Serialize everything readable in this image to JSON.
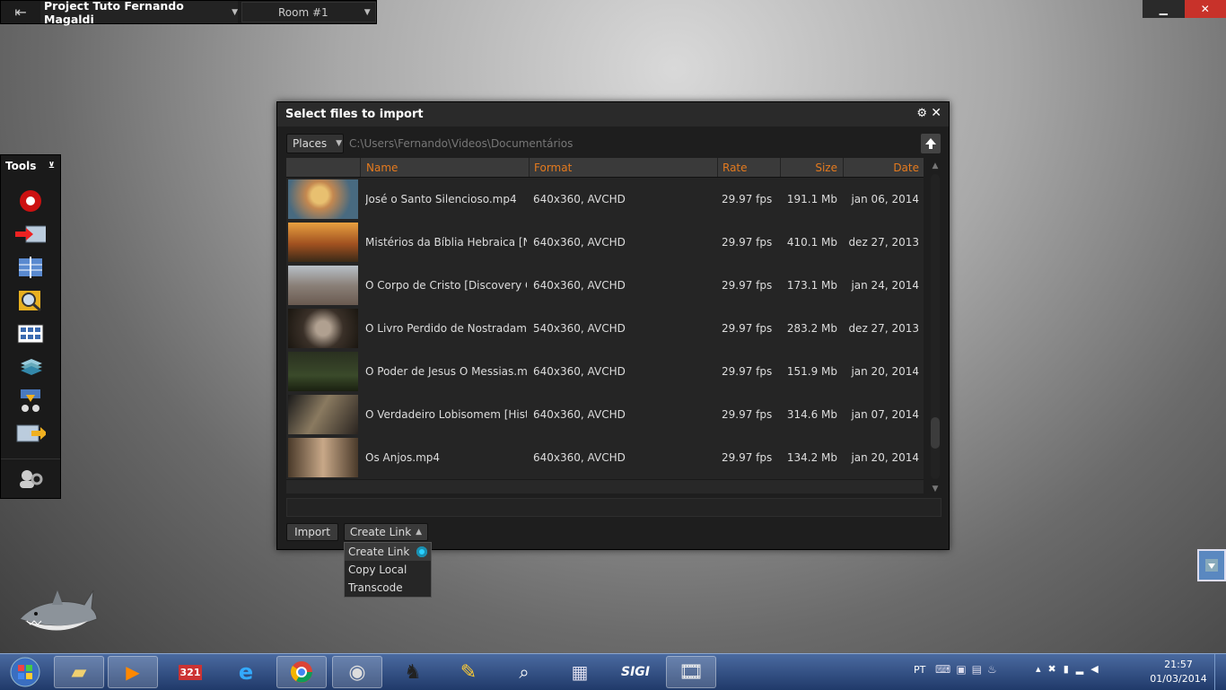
{
  "topbar": {
    "project": "Project Tuto Fernando Magaldi",
    "room": "Room #1"
  },
  "window_controls": {
    "minimize": "▁",
    "close": "✕"
  },
  "tools": {
    "title": "Tools"
  },
  "dialog": {
    "title": "Select files to import",
    "places": "Places",
    "path": "C:\\Users\\Fernando\\Videos\\Documentários",
    "columns": {
      "name": "Name",
      "format": "Format",
      "rate": "Rate",
      "size": "Size",
      "date": "Date"
    },
    "rows": [
      {
        "name": "José o Santo Silencioso.mp4",
        "format": "640x360, AVCHD",
        "rate": "29.97 fps",
        "size": "191.1 Mb",
        "date": "jan 06, 2014"
      },
      {
        "name": "Mistérios da Bíblia Hebraica [Na",
        "format": "640x360, AVCHD",
        "rate": "29.97 fps",
        "size": "410.1 Mb",
        "date": "dez 27, 2013"
      },
      {
        "name": "O Corpo de Cristo [Discovery Ci",
        "format": "640x360, AVCHD",
        "rate": "29.97 fps",
        "size": "173.1 Mb",
        "date": "jan 24, 2014"
      },
      {
        "name": "O Livro Perdido de Nostradamus",
        "format": "540x360, AVCHD",
        "rate": "29.97 fps",
        "size": "283.2 Mb",
        "date": "dez 27, 2013"
      },
      {
        "name": "O Poder de Jesus   O Messias.m",
        "format": "640x360, AVCHD",
        "rate": "29.97 fps",
        "size": "151.9 Mb",
        "date": "jan 20, 2014"
      },
      {
        "name": "O Verdadeiro Lobisomem [Histo",
        "format": "640x360, AVCHD",
        "rate": "29.97 fps",
        "size": "314.6 Mb",
        "date": "jan 07, 2014"
      },
      {
        "name": "Os Anjos.mp4",
        "format": "640x360, AVCHD",
        "rate": "29.97 fps",
        "size": "134.2 Mb",
        "date": "jan 20, 2014"
      }
    ],
    "import_button": "Import",
    "mode_button": "Create Link",
    "mode_options": [
      "Create Link",
      "Copy Local",
      "Transcode"
    ]
  },
  "taskbar": {
    "lang": "PT",
    "time": "21:57",
    "date": "01/03/2014"
  },
  "colors": {
    "accent": "#e47a1e",
    "radio": "#2ad0ff"
  }
}
